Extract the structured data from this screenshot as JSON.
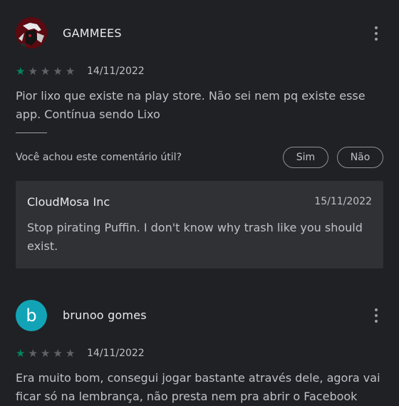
{
  "reviews": [
    {
      "author": "GAMMEES",
      "avatar": "avatar-image",
      "rating": 1,
      "max_rating": 5,
      "date": "14/11/2022",
      "text": "Pior lixo que existe na play store. Não sei nem pq existe esse app. Contínua sendo Lixo",
      "helpful_question": "Você achou este comentário útil?",
      "yes_label": "Sim",
      "no_label": "Não",
      "reply": {
        "author": "CloudMosa Inc",
        "date": "15/11/2022",
        "text": "Stop pirating Puffin. I don't know why trash like you should exist."
      }
    },
    {
      "author": "brunoo gomes",
      "avatar_letter": "b",
      "rating": 1,
      "max_rating": 5,
      "date": "14/11/2022",
      "text": "Era muito bom, consegui jogar bastante através dele, agora vai ficar só na lembrança, não presta nem pra abrir o Facebook"
    }
  ],
  "colors": {
    "background": "#202124",
    "star_filled": "#01875f",
    "star_empty": "#5f6368",
    "reply_background": "#303134",
    "avatar_b": "#12a4b6"
  },
  "icons": {
    "menu": "more-vert-icon",
    "star": "star-icon"
  }
}
